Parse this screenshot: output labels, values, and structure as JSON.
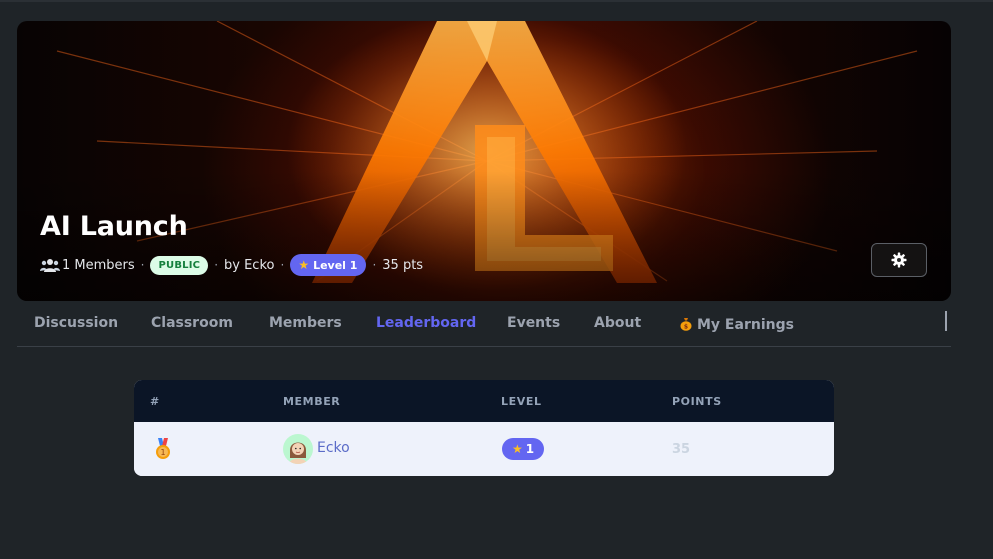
{
  "banner": {
    "title": "AI Launch",
    "members_count": "1 Members",
    "visibility": "PUBLIC",
    "author": "by Ecko",
    "level_label": "Level 1",
    "points": "35 pts"
  },
  "tabs": [
    {
      "label": "Discussion"
    },
    {
      "label": "Classroom"
    },
    {
      "label": "Members"
    },
    {
      "label": "Leaderboard",
      "active": true
    },
    {
      "label": "Events"
    },
    {
      "label": "About"
    },
    {
      "label": "My Earnings",
      "icon": "money-bag-icon"
    }
  ],
  "leaderboard": {
    "headers": {
      "rank": "#",
      "member": "MEMBER",
      "level": "LEVEL",
      "points": "POINTS"
    },
    "rows": [
      {
        "rank_icon": "bronze-medal-icon",
        "member": "Ecko",
        "level": "1",
        "points": "35"
      }
    ]
  },
  "colors": {
    "accent": "#6366f1",
    "public_badge_bg": "#dcfce7",
    "public_badge_text": "#15803d"
  }
}
